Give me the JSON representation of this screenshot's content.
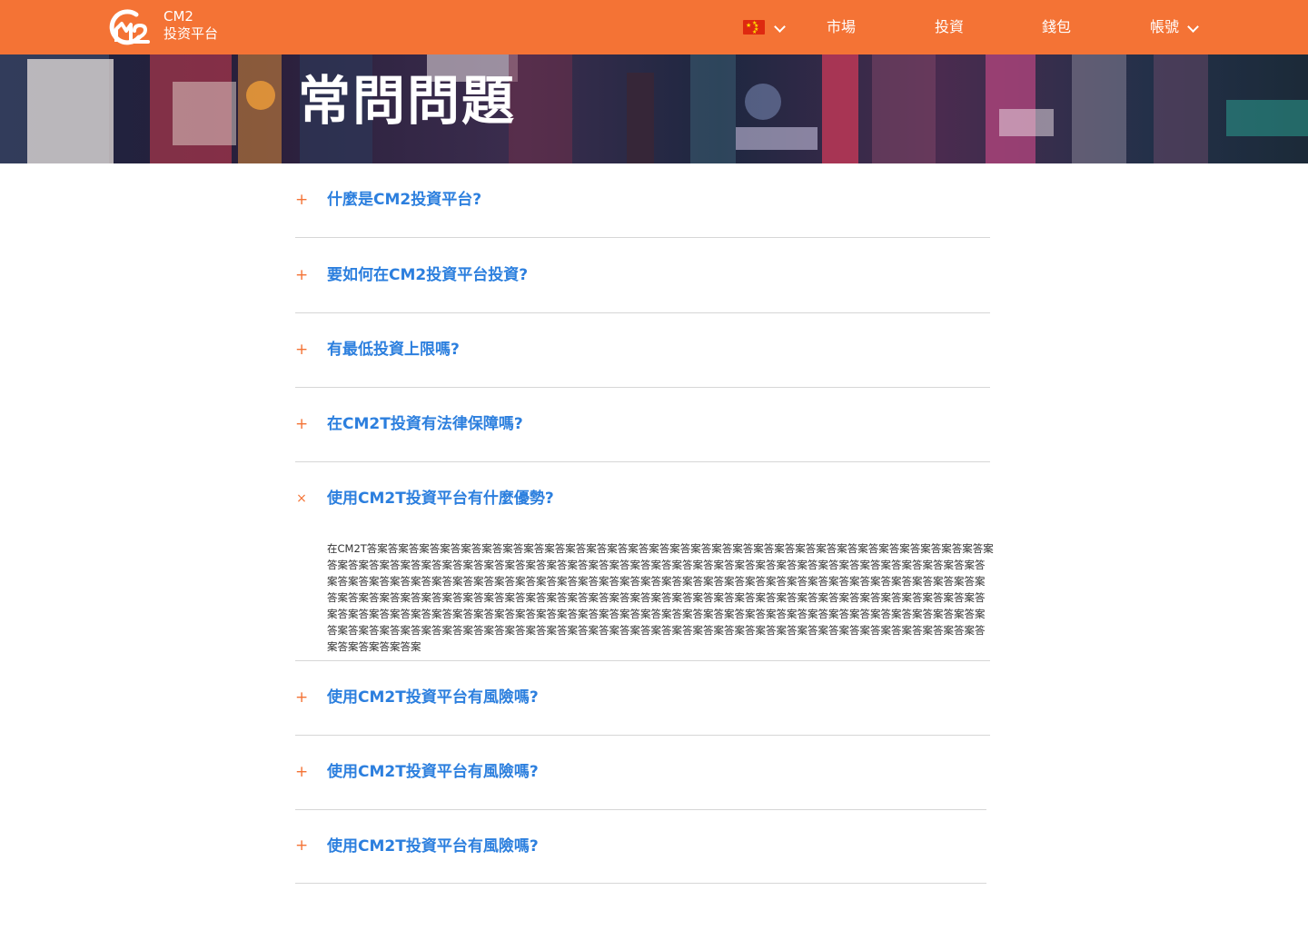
{
  "header": {
    "brand_line1": "CM2",
    "brand_line2": "投资平台",
    "nav": [
      {
        "label": "市場"
      },
      {
        "label": "投資"
      },
      {
        "label": "錢包"
      },
      {
        "label": "帳號"
      }
    ],
    "language_flag": "china-flag-icon",
    "colors": {
      "bar": "#f47335",
      "text": "#ffffff"
    }
  },
  "hero": {
    "title": "常問問題"
  },
  "faq": {
    "colors": {
      "question": "#2c7fde",
      "toggle": "#f47335",
      "divider": "#d6d6d6"
    },
    "items": [
      {
        "question": "什麼是CM2投資平台?",
        "expanded": false,
        "toggle": "+"
      },
      {
        "question": "要如何在CM2投資平台投資?",
        "expanded": false,
        "toggle": "+"
      },
      {
        "question": "有最低投資上限嗎?",
        "expanded": false,
        "toggle": "+"
      },
      {
        "question": "在CM2T投資有法律保障嗎?",
        "expanded": false,
        "toggle": "+"
      },
      {
        "question": "使用CM2T投資平台有什麼優勢?",
        "expanded": true,
        "toggle": "×",
        "answer": "在CM2T答案答案答案答案答案答案答案答案答案答案答案答案答案答案答案答案答案答案答案答案答案答案答案答案答案答案答案答案答案答案答案答案答案答案答案答案答案答案答案答案答案答案答案答案答案答案答案答案答案答案答案答案答案答案答案答案答案答案答案答案答案答案答案答案答案答案答案答案答案答案答案答案答案答案答案答案答案答案答案答案答案答案答案答案答案答案答案答案答案答案答案答案答案答案答案答案答案答案答案答案答案答案答案答案答案答案答案答案答案答案答案答案答案答案答案答案答案答案答案答案答案答案答案答案答案答案答案答案答案答案答案答案答案答案答案答案答案答案答案答案答案答案答案答案答案答案答案答案答案答案答案答案答案答案答案答案答案答案答案答案答案答案答案答案答案答案答案答案答案答案答案答案答案答案答案答案答案答案答案答案答案答案答案答案答案答案答案答案答案答案答案答案"
      },
      {
        "question": "使用CM2T投資平台有風險嗎?",
        "expanded": false,
        "toggle": "+"
      },
      {
        "question": "使用CM2T投資平台有風險嗎?",
        "expanded": false,
        "toggle": "+"
      },
      {
        "question": "使用CM2T投資平台有風險嗎?",
        "expanded": false,
        "toggle": "+"
      }
    ]
  }
}
